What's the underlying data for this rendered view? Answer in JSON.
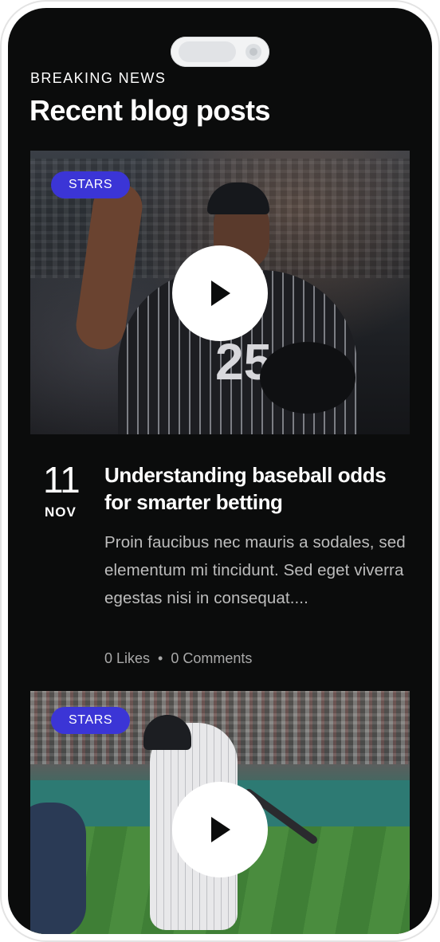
{
  "header": {
    "eyebrow": "BREAKING NEWS",
    "title": "Recent blog posts"
  },
  "posts": [
    {
      "badge": "STARS",
      "image_icon": "play-icon",
      "date_day": "11",
      "date_month": "NOV",
      "title": "Understanding baseball odds for smarter betting",
      "excerpt": "Proin faucibus nec mauris a sodales, sed elementum mi tincidunt. Sed eget viverra egestas nisi in consequat....",
      "likes": "0 Likes",
      "separator": "•",
      "comments": "0 Comments"
    },
    {
      "badge": "STARS",
      "image_icon": "play-icon"
    }
  ],
  "colors": {
    "background": "#0b0c0c",
    "badge": "#3b35d6",
    "text": "#ffffff",
    "muted": "#bdbdbd"
  }
}
